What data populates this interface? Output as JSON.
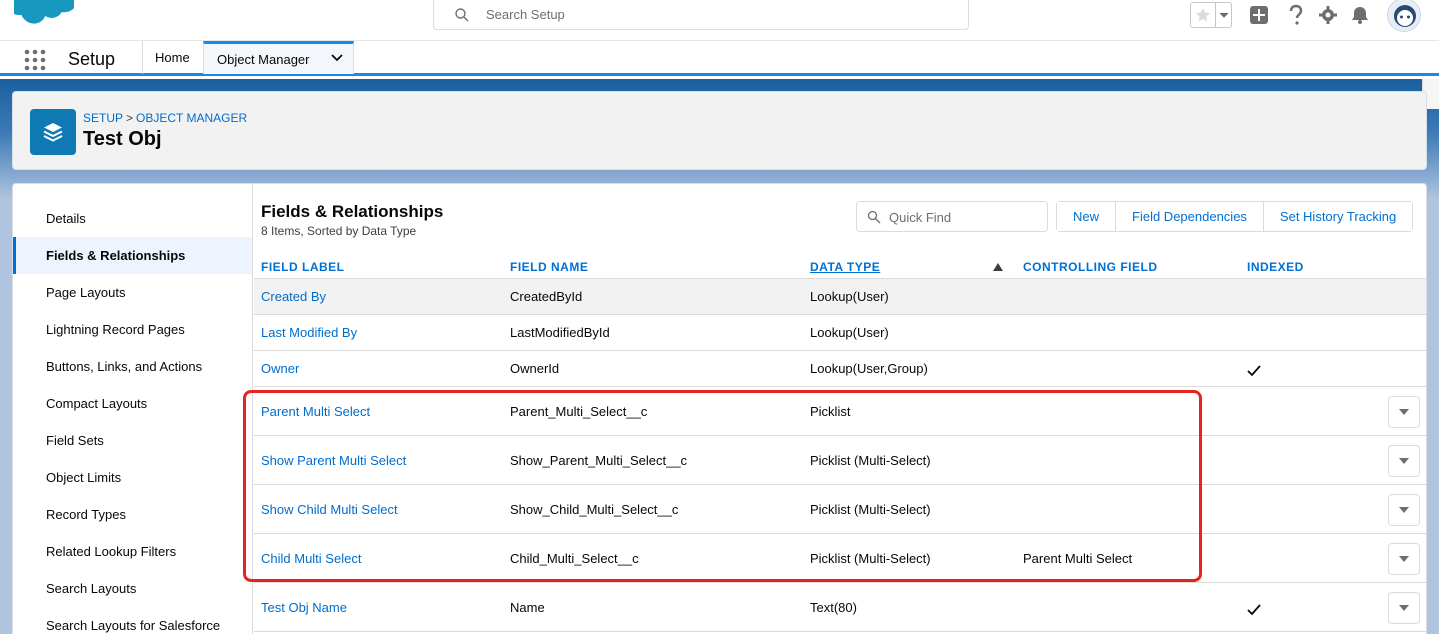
{
  "header": {
    "search_placeholder": "Search Setup"
  },
  "context": {
    "app_name": "Setup",
    "tabs": [
      "Home",
      "Object Manager"
    ]
  },
  "page": {
    "breadcrumb": [
      "SETUP",
      "OBJECT MANAGER"
    ],
    "breadcrumb_sep": ">",
    "title": "Test Obj"
  },
  "sidebar": {
    "items": [
      "Details",
      "Fields & Relationships",
      "Page Layouts",
      "Lightning Record Pages",
      "Buttons, Links, and Actions",
      "Compact Layouts",
      "Field Sets",
      "Object Limits",
      "Record Types",
      "Related Lookup Filters",
      "Search Layouts",
      "Search Layouts for Salesforce"
    ],
    "active_index": 1
  },
  "section": {
    "title": "Fields & Relationships",
    "subtitle": "8 Items, Sorted by Data Type",
    "quickfind_placeholder": "Quick Find",
    "buttons": [
      "New",
      "Field Dependencies",
      "Set History Tracking"
    ]
  },
  "table": {
    "columns": [
      "FIELD LABEL",
      "FIELD NAME",
      "DATA TYPE",
      "CONTROLLING FIELD",
      "INDEXED"
    ],
    "sorted_column": "DATA TYPE",
    "sort_direction": "ascending",
    "rows": [
      {
        "label": "Created By",
        "name": "CreatedById",
        "type": "Lookup(User)",
        "controlling": "",
        "indexed": false,
        "menu": false
      },
      {
        "label": "Last Modified By",
        "name": "LastModifiedById",
        "type": "Lookup(User)",
        "controlling": "",
        "indexed": false,
        "menu": false
      },
      {
        "label": "Owner",
        "name": "OwnerId",
        "type": "Lookup(User,Group)",
        "controlling": "",
        "indexed": true,
        "menu": false
      },
      {
        "label": "Parent Multi Select",
        "name": "Parent_Multi_Select__c",
        "type": "Picklist",
        "controlling": "",
        "indexed": false,
        "menu": true
      },
      {
        "label": "Show Parent Multi Select",
        "name": "Show_Parent_Multi_Select__c",
        "type": "Picklist (Multi-Select)",
        "controlling": "",
        "indexed": false,
        "menu": true
      },
      {
        "label": "Show Child Multi Select",
        "name": "Show_Child_Multi_Select__c",
        "type": "Picklist (Multi-Select)",
        "controlling": "",
        "indexed": false,
        "menu": true
      },
      {
        "label": "Child Multi Select",
        "name": "Child_Multi_Select__c",
        "type": "Picklist (Multi-Select)",
        "controlling": "Parent Multi Select",
        "indexed": false,
        "menu": true
      },
      {
        "label": "Test Obj Name",
        "name": "Name",
        "type": "Text(80)",
        "controlling": "",
        "indexed": true,
        "menu": true
      }
    ]
  },
  "colors": {
    "brand_blue": "#0070d2",
    "highlight_red": "#e8231e"
  }
}
